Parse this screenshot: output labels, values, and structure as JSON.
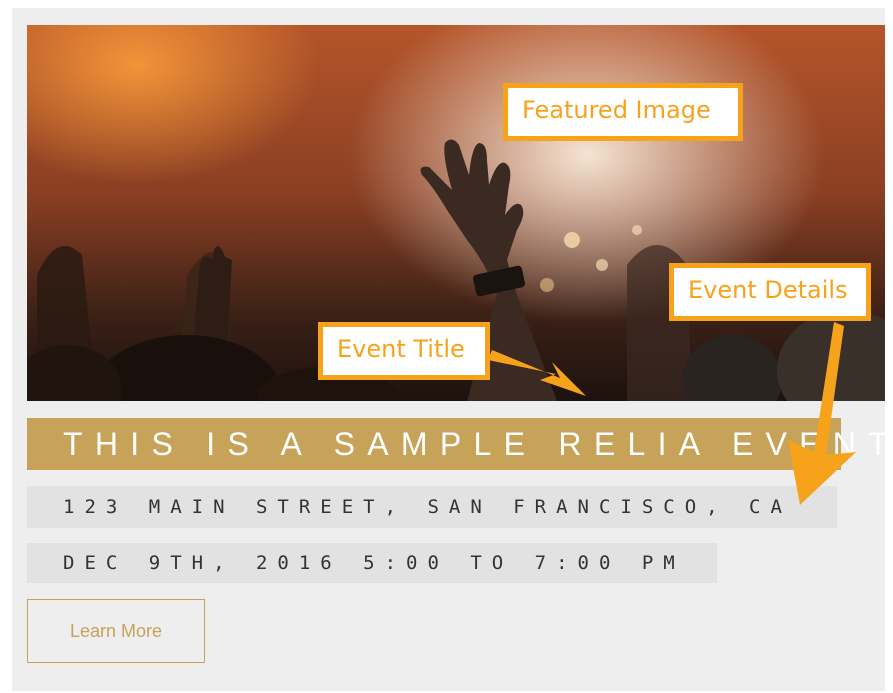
{
  "annotations": {
    "featured_image": "Featured Image",
    "event_details": "Event Details",
    "event_title": "Event Title"
  },
  "event": {
    "title": "THIS IS A SAMPLE RELIA EVENT",
    "address": "123 MAIN STREET, SAN FRANCISCO, CA",
    "datetime": "DEC 9TH, 2016 5:00 TO 7:00 PM",
    "cta_label": "Learn More"
  },
  "colors": {
    "accent_gold": "#c7a259",
    "callout_orange": "#f7a21b",
    "card_background": "#eeeeee",
    "detail_band": "#e2e2e2"
  },
  "icons": {
    "arrow": "callout-arrow-icon"
  }
}
